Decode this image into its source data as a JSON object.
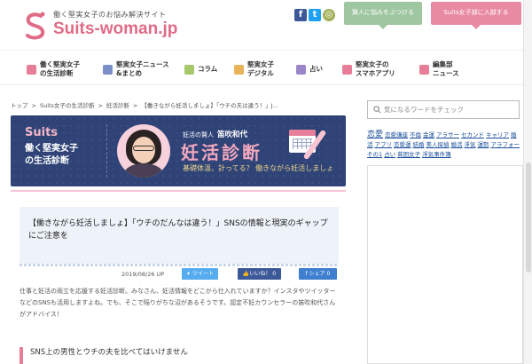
{
  "header": {
    "tagline": "働く堅実女子のお悩み解決サイト",
    "logo_text": "Suits-woman.jp",
    "social": [
      {
        "name": "facebook-icon",
        "glyph": "f",
        "cls": "fb"
      },
      {
        "name": "twitter-icon",
        "glyph": "t",
        "cls": "tw"
      },
      {
        "name": "line-icon",
        "glyph": "◎",
        "cls": "ln"
      }
    ],
    "ask_button": "賢人に悩みをぶつける",
    "join_button": "Suits女子部に入部する"
  },
  "nav": {
    "items": [
      {
        "label": "働く堅実女子\nの生活診断",
        "icon": "clipboard-icon",
        "color": "#e87d98"
      },
      {
        "label": "堅実女子ニュース\n&まとめ",
        "icon": "news-icon",
        "color": "#7b8fc9"
      },
      {
        "label": "コラム",
        "icon": "book-icon",
        "color": "#a6c76a"
      },
      {
        "label": "堅実女子\nデジタル",
        "icon": "bag-icon",
        "color": "#e9b35a"
      },
      {
        "label": "占い",
        "icon": "star-icon",
        "color": "#9a86c6"
      },
      {
        "label": "堅実女子の\nスマホアプリ",
        "icon": "smartphone-icon",
        "color": "#e87d98"
      },
      {
        "label": "編集部\nニュース",
        "icon": "megaphone-icon",
        "color": "#e87d98"
      }
    ]
  },
  "breadcrumb": [
    "トップ",
    ">",
    "Suits女子の生活診断",
    ">",
    "妊活診断",
    ">",
    "【働きながら妊活しましょ】「ウチの夫は違う！」J..."
  ],
  "banner": {
    "suits": "Suits",
    "title": "働く堅実女子\nの生活診断",
    "kicker": "妊活の賢人",
    "name": "笛吹和代",
    "main": "妊活診断",
    "sub": "基礎体温、計ってる？ 働きながら妊活しましょ"
  },
  "article": {
    "title": "【働きながら妊活しましょ】「ウチのだんなは違う！」SNSの情報と現実のギャップにご注意を",
    "date": "2019/08/26 UP",
    "tweet": "ツイート",
    "like": "いいね！ 0",
    "share": "シェア 0",
    "intro": "仕事と妊活の両立を応援する妊活診断。みなさん、妊活情報をどこから仕入れていますか？インスタやツイッターなどのSNSも活用しますよね。でも、そこで陥りがちな沼があるそうです。認定不妊カウンセラーの笛吹和代さんがアドバイス！",
    "section_heading": "SNS上の男性とウチの夫を比べてはいけません"
  },
  "sidebar": {
    "search_placeholder": "気になるワードをチェック",
    "tags": [
      {
        "t": "恋愛",
        "big": true
      },
      {
        "t": "恋愛講座"
      },
      {
        "t": "不倫"
      },
      {
        "t": "金運"
      },
      {
        "t": "アラサー"
      },
      {
        "t": "セカンド"
      },
      {
        "t": "キャリア"
      },
      {
        "t": "婚活"
      },
      {
        "t": "アプリ"
      },
      {
        "t": "恋愛運"
      },
      {
        "t": "結婚"
      },
      {
        "t": "美人探偵"
      },
      {
        "t": "婚活"
      },
      {
        "t": "浮気"
      },
      {
        "t": "運勢"
      },
      {
        "t": "アラフォー"
      },
      {
        "t": "その1"
      },
      {
        "t": "占い"
      },
      {
        "t": "貧困女子"
      },
      {
        "t": "浮気事件簿"
      }
    ]
  }
}
